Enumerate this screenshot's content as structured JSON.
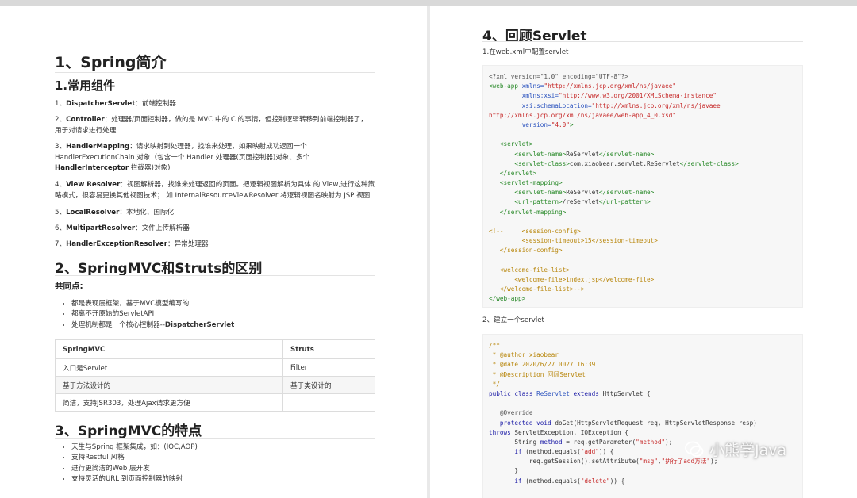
{
  "left": {
    "h1": "1、Spring简介",
    "h2_components": "1.常用组件",
    "components": [
      {
        "term": "DispatcherServlet",
        "lines": [
          "1、",
          "：前端控制器"
        ]
      },
      {
        "term": "Controller",
        "lines": [
          "2、",
          "：处理器/页面控制器，做的是 MVC 中的 C 的事情，但控制逻辑转移到前端控制器了，",
          "用于对请求进行处理"
        ]
      },
      {
        "term": "HandlerMapping",
        "lines": [
          "3、",
          "：请求映射到处理器，找谁来处理，如果映射成功返回一个",
          "HandlerExecutionChain 对象（包含一个 Handler 处理器(页面控制器)对象、多个",
          "拦截器)对象)"
        ],
        "term2": "HandlerInterceptor"
      },
      {
        "term": "View Resolver",
        "lines": [
          "4、",
          "：视图解析器，找谁来处理返回的页面。把逻辑视图解析为具体 的 View,进行这种策",
          "略模式，很容易更换其他视图技术； 如 InternalResourceViewResolver 将逻辑视图名映射为 JSP 视图"
        ]
      },
      {
        "term": "LocalResolver",
        "lines": [
          "5、",
          "：本地化、国际化"
        ]
      },
      {
        "term": "MultipartResolver",
        "lines": [
          "6、",
          "：文件上传解析器"
        ]
      },
      {
        "term": "HandlerExceptionResolver",
        "lines": [
          "7、",
          "：异常处理器"
        ]
      }
    ],
    "h1_diff": "2、SpringMVC和Struts的区别",
    "common_title": "共同点:",
    "common_points": [
      "都是表现层框架，基于MVC模型编写的",
      "都离不开原始的ServletAPI"
    ],
    "common_point3_prefix": "处理机制都是一个核心控制器--",
    "common_point3_bold": "DispatcherServlet",
    "table": {
      "headers": [
        "SpringMVC",
        "Struts"
      ],
      "rows": [
        [
          "入口是Servlet",
          "Filter"
        ],
        [
          "基于方法设计的",
          "基于类设计的"
        ],
        [
          "简洁，支持JSR303，处理Ajax请求更方便",
          ""
        ]
      ]
    },
    "h1_features": "3、SpringMVC的特点",
    "features": [
      "天生与Spring 框架集成，如：(IOC,AOP)",
      "支持Restful 风格",
      "进行更简洁的Web 层开发",
      "支持灵活的URL 到页面控制器的映射"
    ]
  },
  "right": {
    "h1": "4、回顾Servlet",
    "step1": "1.在web.xml中配置servlet",
    "xml_lines": [
      [
        [
          "p",
          "<?xml version=\"1.0\" encoding=\"UTF-8\"?>"
        ]
      ],
      [
        [
          "t",
          "<web-app "
        ],
        [
          "a",
          "xmlns="
        ],
        [
          "s",
          "\"http://xmlns.jcp.org/xml/ns/javaee\""
        ]
      ],
      [
        [
          "x",
          "         "
        ],
        [
          "a",
          "xmlns:xsi="
        ],
        [
          "s",
          "\"http://www.w3.org/2001/XMLSchema-instance\""
        ]
      ],
      [
        [
          "x",
          "         "
        ],
        [
          "a",
          "xsi:schemaLocation="
        ],
        [
          "s",
          "\"http://xmlns.jcp.org/xml/ns/javaee"
        ]
      ],
      [
        [
          "s",
          "http://xmlns.jcp.org/xml/ns/javaee/web-app_4_0.xsd\""
        ]
      ],
      [
        [
          "x",
          "         "
        ],
        [
          "a",
          "version="
        ],
        [
          "s",
          "\"4.0\""
        ],
        [
          "t",
          ">"
        ]
      ],
      [
        [
          "x",
          ""
        ]
      ],
      [
        [
          "x",
          "   "
        ],
        [
          "t",
          "<servlet>"
        ]
      ],
      [
        [
          "x",
          "       "
        ],
        [
          "t",
          "<servlet-name>"
        ],
        [
          "x",
          "ReServlet"
        ],
        [
          "t",
          "</servlet-name>"
        ]
      ],
      [
        [
          "x",
          "       "
        ],
        [
          "t",
          "<servlet-class>"
        ],
        [
          "x",
          "com.xiaobear.servlet.ReServlet"
        ],
        [
          "t",
          "</servlet-class>"
        ]
      ],
      [
        [
          "x",
          "   "
        ],
        [
          "t",
          "</servlet>"
        ]
      ],
      [
        [
          "x",
          "   "
        ],
        [
          "t",
          "<servlet-mapping>"
        ]
      ],
      [
        [
          "x",
          "       "
        ],
        [
          "t",
          "<servlet-name>"
        ],
        [
          "x",
          "ReServlet"
        ],
        [
          "t",
          "</servlet-name>"
        ]
      ],
      [
        [
          "x",
          "       "
        ],
        [
          "t",
          "<url-pattern>"
        ],
        [
          "x",
          "/reServlet"
        ],
        [
          "t",
          "</url-pattern>"
        ]
      ],
      [
        [
          "x",
          "   "
        ],
        [
          "t",
          "</servlet-mapping>"
        ]
      ],
      [
        [
          "x",
          ""
        ]
      ],
      [
        [
          "c",
          "<!--     <session-config>"
        ]
      ],
      [
        [
          "c",
          "         <session-timeout>15</session-timeout>"
        ]
      ],
      [
        [
          "c",
          "   </session-config>"
        ]
      ],
      [
        [
          "x",
          ""
        ]
      ],
      [
        [
          "c",
          "   <welcome-file-list>"
        ]
      ],
      [
        [
          "c",
          "       <welcome-file>index.jsp</welcome-file>"
        ]
      ],
      [
        [
          "c",
          "   </welcome-file-list>-->"
        ]
      ],
      [
        [
          "t",
          "</web-app>"
        ]
      ]
    ],
    "step2": "2、建立一个servlet",
    "java_lines": [
      [
        [
          "c",
          "/**"
        ]
      ],
      [
        [
          "c",
          " * @author xiaobear"
        ]
      ],
      [
        [
          "c",
          " * @date 2020/6/27 0027 16:39"
        ]
      ],
      [
        [
          "c",
          " * @Description 回顾Servlet"
        ]
      ],
      [
        [
          "c",
          " */"
        ]
      ],
      [
        [
          "k",
          "public class "
        ],
        [
          "a",
          "ReServlet "
        ],
        [
          "k",
          "extends "
        ],
        [
          "x",
          "HttpServlet {"
        ]
      ],
      [
        [
          "x",
          ""
        ]
      ],
      [
        [
          "x",
          "   "
        ],
        [
          "p",
          "@Override"
        ]
      ],
      [
        [
          "x",
          "   "
        ],
        [
          "k",
          "protected void "
        ],
        [
          "x",
          "doGet(HttpServletRequest req, HttpServletResponse resp)"
        ]
      ],
      [
        [
          "k",
          "throws "
        ],
        [
          "x",
          "ServletException, IOException {"
        ]
      ],
      [
        [
          "x",
          "       String "
        ],
        [
          "k",
          "method "
        ],
        [
          "x",
          "= req.getParameter("
        ],
        [
          "s",
          "\"method\""
        ],
        [
          "x",
          ");"
        ]
      ],
      [
        [
          "x",
          "       "
        ],
        [
          "k",
          "if "
        ],
        [
          "x",
          "(method.equals("
        ],
        [
          "s",
          "\"add\""
        ],
        [
          "x",
          ")) {"
        ]
      ],
      [
        [
          "x",
          "           req.getSession().setAttribute("
        ],
        [
          "s",
          "\"msg\""
        ],
        [
          "x",
          ","
        ],
        [
          "s",
          "\"执行了add方法\""
        ],
        [
          "x",
          ");"
        ]
      ],
      [
        [
          "x",
          "       }"
        ]
      ],
      [
        [
          "x",
          "       "
        ],
        [
          "k",
          "if "
        ],
        [
          "x",
          "(method.equals("
        ],
        [
          "s",
          "\"delete\""
        ],
        [
          "x",
          ")) {"
        ]
      ]
    ],
    "watermark": "小熊学Java"
  }
}
